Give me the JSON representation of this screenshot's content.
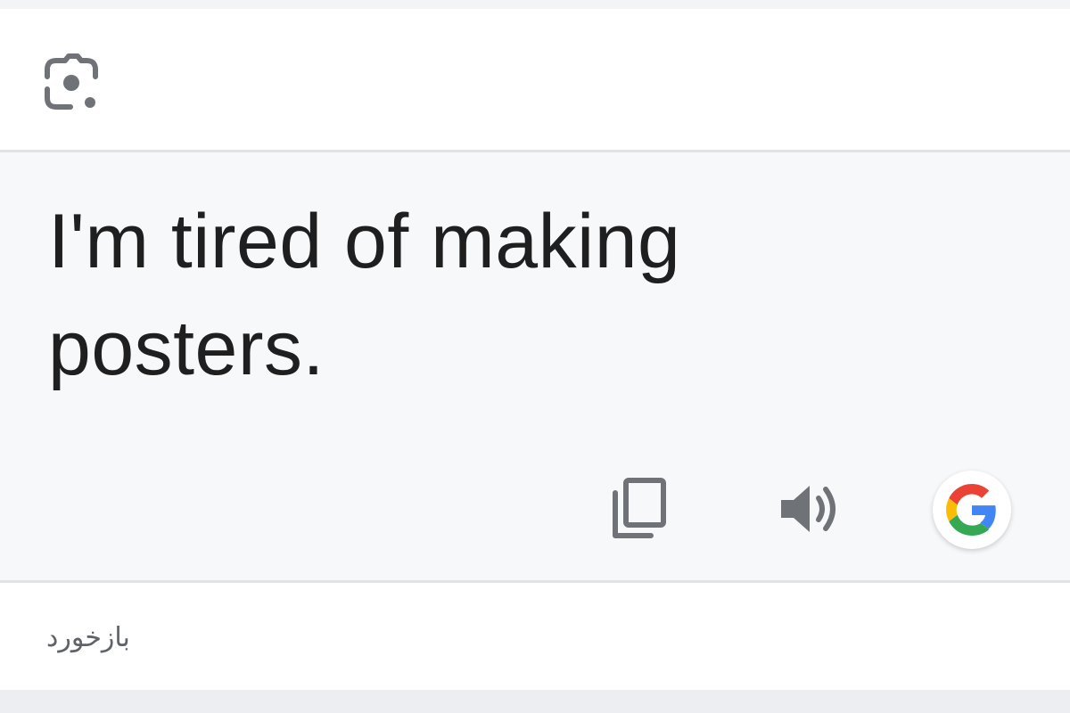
{
  "header": {
    "lens_icon": "google-lens-camera-icon"
  },
  "result": {
    "translated_text": "I'm tired of making posters."
  },
  "actions": {
    "copy_icon": "copy-icon",
    "speak_icon": "volume-speaker-icon",
    "google_icon": "google-logo-icon"
  },
  "feedback": {
    "label": "بازخورد"
  },
  "colors": {
    "text": "#1f1f1f",
    "icon_gray": "#6f7378",
    "panel_bg": "#f7f8fa",
    "google_blue": "#4285F4",
    "google_red": "#EA4335",
    "google_yellow": "#FBBC05",
    "google_green": "#34A853"
  }
}
